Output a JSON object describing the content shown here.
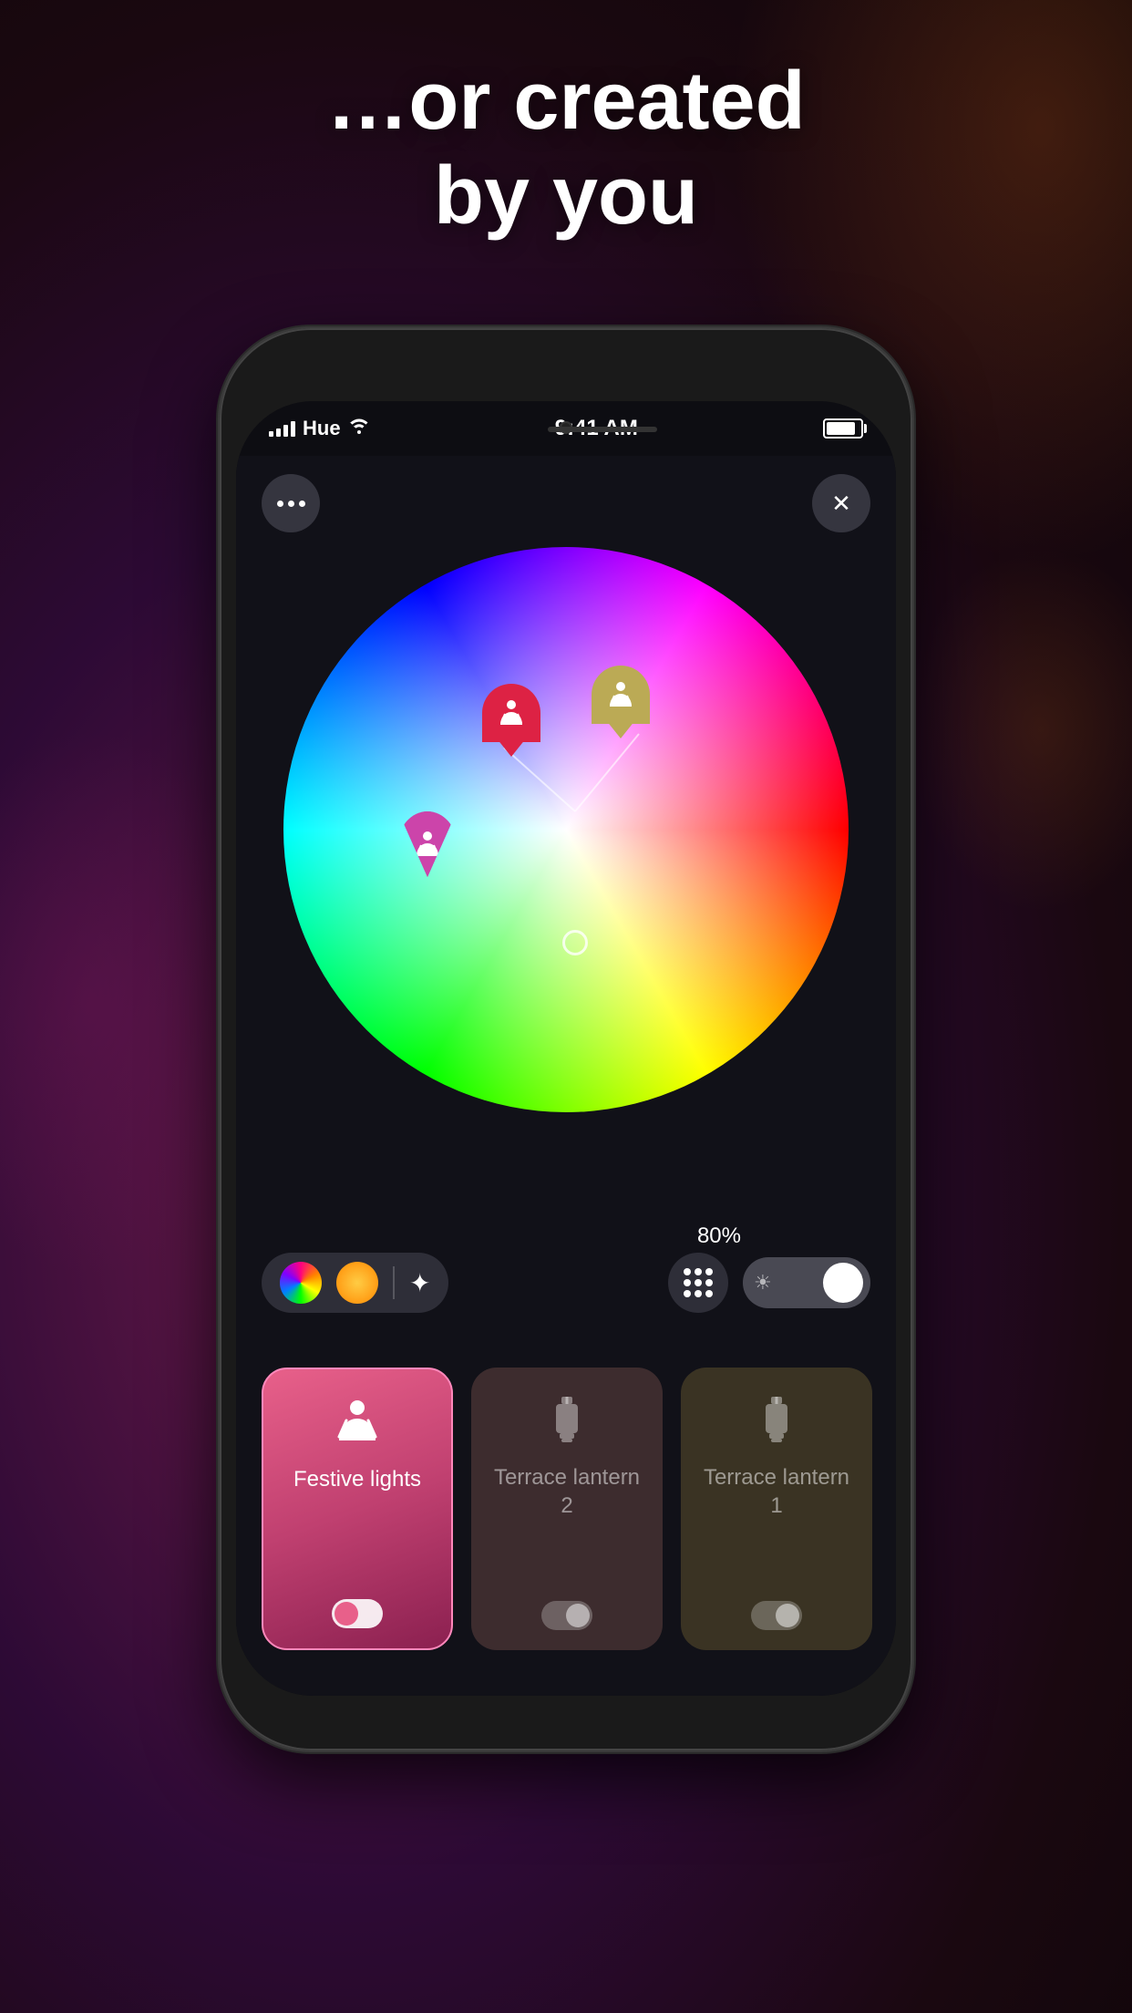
{
  "headline": {
    "line1": "…or created",
    "line2": "by you"
  },
  "status_bar": {
    "carrier": "Hue",
    "time": "9:41 AM",
    "battery_pct": 85
  },
  "top_buttons": {
    "more_label": "•••",
    "close_label": "✕"
  },
  "color_wheel": {
    "brightness_percent": "80%"
  },
  "light_cards": [
    {
      "id": "festive-lights",
      "label": "Festive lights",
      "active": true,
      "toggle_on": true
    },
    {
      "id": "terrace-lantern-2",
      "label": "Terrace lantern 2",
      "active": false,
      "toggle_on": false
    },
    {
      "id": "terrace-lantern-1",
      "label": "Terrace lantern 1",
      "active": false,
      "toggle_on": false
    }
  ],
  "colors": {
    "accent_pink": "#e8608a",
    "card_inactive_warm": "rgba(80,55,55,0.7)",
    "card_inactive_olive": "rgba(75,65,40,0.7)"
  }
}
